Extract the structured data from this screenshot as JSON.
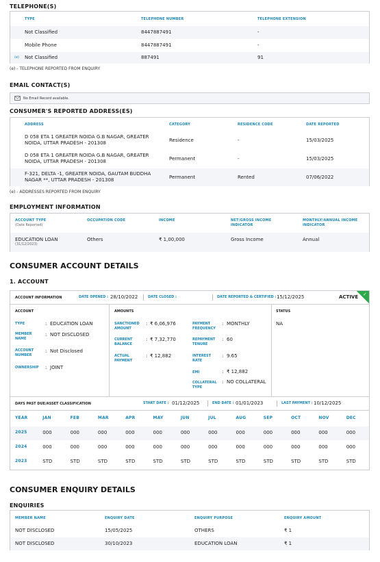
{
  "telephones": {
    "title": "TELEPHONE(S)",
    "headers": [
      "TYPE",
      "TELEPHONE NUMBER",
      "TELEPHONE EXTENSION"
    ],
    "rows": [
      {
        "marker": "",
        "type": "Not Classified",
        "number": "8447887491",
        "ext": "-"
      },
      {
        "marker": "",
        "type": "Mobile Phone",
        "number": "8447887491",
        "ext": "-"
      },
      {
        "marker": "(e)",
        "type": "Not Classified",
        "number": "887491",
        "ext": "91"
      }
    ],
    "note": "(e) - TELEPHONE REPORTED FROM ENQUIRY"
  },
  "email": {
    "title": "EMAIL CONTACT(S)",
    "message": "No Email Record available."
  },
  "addresses": {
    "title": "CONSUMER'S REPORTED ADDRESS(ES)",
    "headers": [
      "ADDRESS",
      "CATEGORY",
      "RESIDENCE CODE",
      "DATE REPORTED"
    ],
    "rows": [
      {
        "address": "D 058 ETA 1 GREATER NOIDA G.B NAGAR, GREATER NOIDA, UTTAR PRADESH - 201308",
        "category": "Residence",
        "code": "-",
        "date": "15/03/2025"
      },
      {
        "address": "D 058 ETA 1 GREATER NOIDA G.B NAGAR, GREATER NOIDA, UTTAR PRADESH - 201308",
        "category": "Permanent",
        "code": "-",
        "date": "15/03/2025"
      },
      {
        "address": "F-321, DELTA -1, GREATER NOIDA, GAUTAM BUDDHA NAGAR **, UTTAR PRADESH - 201308",
        "category": "Permanent",
        "code": "Rented",
        "date": "07/06/2022"
      }
    ],
    "note": "(e) - ADDRESSES REPORTED FROM ENQUIRY"
  },
  "employment": {
    "title": "EMPLOYMENT INFORMATION",
    "headers": [
      "ACCOUNT TYPE",
      "OCCUPATION CODE",
      "INCOME",
      "NET/GROSS INCOME INDICATOR",
      "MONTHLY/ANNUAL INCOME INDICATOR"
    ],
    "header_sub": "(Date Reported)",
    "row": {
      "account_type": "EDUCATION LOAN",
      "date": "(31/12/2023)",
      "occupation": "Others",
      "income": "₹ 1,00,000",
      "net_gross": "Gross Income",
      "monthly_annual": "Annual"
    }
  },
  "account_details": {
    "title": "CONSUMER ACCOUNT DETAILS",
    "subtitle": "1. ACCOUNT",
    "info_label": "ACCOUNT INFORMATION",
    "date_opened_label": "DATE OPENED :",
    "date_opened": "28/10/2022",
    "date_closed_label": "DATE CLOSED :",
    "date_closed": "",
    "date_reported_label": "DATE REPORTED & CERTIFIED :",
    "date_reported": "15/12/2025",
    "status_badge": "ACTIVE",
    "account_col": "ACCOUNT",
    "amounts_col": "AMOUNTS",
    "status_col": "STATUS",
    "status_value": "NA",
    "account_fields": [
      {
        "label": "TYPE",
        "value": "EDUCATION LOAN"
      },
      {
        "label": "MEMBER NAME",
        "value": "NOT DISCLOSED"
      },
      {
        "label": "ACCOUNT NUMBER",
        "value": "Not Disclosed"
      },
      {
        "label": "OWNERSHIP",
        "value": "JOINT"
      }
    ],
    "amount_fields": [
      {
        "label": "SANCTIONED AMOUNT",
        "value": "₹ 6,06,976"
      },
      {
        "label": "CURRENT BALANCE",
        "value": "₹ 7,32,770"
      },
      {
        "label": "ACTUAL PAYMENT",
        "value": "₹ 12,882"
      }
    ],
    "payment_fields": [
      {
        "label": "PAYMENT FREQUENCY",
        "value": "MONTHLY"
      },
      {
        "label": "REPAYMENT TENURE",
        "value": "60"
      },
      {
        "label": "INTEREST RATE",
        "value": "9.65"
      },
      {
        "label": "EMI",
        "value": "₹ 12,882"
      },
      {
        "label": "COLLATERAL TYPE",
        "value": "NO COLLATERAL"
      }
    ],
    "dpd": {
      "label": "DAYS PAST DUE/ASSET CLASSIFICATION",
      "start_label": "START DATE :",
      "start": "01/12/2025",
      "end_label": "END DATE :",
      "end": "01/01/2023",
      "last_label": "LAST PAYMENT :",
      "last": "10/12/2025",
      "months": [
        "YEAR",
        "JAN",
        "FEB",
        "MAR",
        "APR",
        "MAY",
        "JUN",
        "JUL",
        "AUG",
        "SEP",
        "OCT",
        "NOV",
        "DEC"
      ],
      "rows": [
        {
          "year": "2025",
          "values": [
            "000",
            "000",
            "000",
            "000",
            "000",
            "000",
            "000",
            "000",
            "000",
            "000",
            "000",
            "000"
          ]
        },
        {
          "year": "2024",
          "values": [
            "000",
            "000",
            "000",
            "000",
            "000",
            "000",
            "000",
            "000",
            "000",
            "000",
            "000",
            "000"
          ]
        },
        {
          "year": "2023",
          "values": [
            "STD",
            "STD",
            "STD",
            "STD",
            "STD",
            "STD",
            "STD",
            "STD",
            "STD",
            "STD",
            "STD",
            "STD"
          ]
        }
      ]
    }
  },
  "enquiry": {
    "title": "CONSUMER ENQUIRY DETAILS",
    "subtitle": "ENQUIRIES",
    "headers": [
      "MEMBER NAME",
      "ENQUIRY DATE",
      "ENQUIRY PURPOSE",
      "ENQUIRY AMOUNT"
    ],
    "rows": [
      {
        "member": "NOT DISCLOSED",
        "date": "15/05/2025",
        "purpose": "OTHERS",
        "amount": "₹ 1"
      },
      {
        "member": "NOT DISCLOSED",
        "date": "30/10/2023",
        "purpose": "EDUCATION LOAN",
        "amount": "₹ 1"
      }
    ]
  },
  "colors": {
    "accent": "#1a86b5",
    "active": "#2aa84a",
    "border": "#c9ccd2",
    "stripe": "#f3f5f8"
  }
}
